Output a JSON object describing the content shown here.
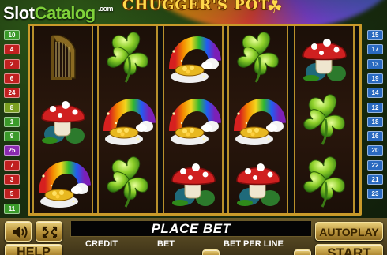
{
  "watermark": {
    "slot": "Slot",
    "catalog": "Catalog",
    "com": ".com"
  },
  "title": {
    "text": "CHUGGER'S POT"
  },
  "paylines": {
    "left": [
      "10",
      "4",
      "2",
      "6",
      "24",
      "8",
      "1",
      "9",
      "25",
      "7",
      "3",
      "5",
      "11"
    ],
    "right": [
      "15",
      "17",
      "13",
      "19",
      "14",
      "12",
      "18",
      "16",
      "20",
      "22",
      "21",
      "23"
    ]
  },
  "reels": [
    [
      "harp",
      "mushroom",
      "pot"
    ],
    [
      "clover",
      "pot",
      "clover"
    ],
    [
      "pot",
      "pot",
      "mushroom"
    ],
    [
      "clover",
      "pot",
      "mushroom"
    ],
    [
      "mushroom",
      "clover",
      "clover"
    ]
  ],
  "colors": {
    "frame_gold": "#c99a2a",
    "button_gold": "#e9d07a",
    "line_colors_left": [
      "#3a9a2a",
      "#c02020",
      "#c02020",
      "#c02020",
      "#c02020",
      "#7aa020",
      "#3a9a2a",
      "#3a9a2a",
      "#8a2ab0",
      "#c02020",
      "#c02020",
      "#c02020",
      "#3a9a2a"
    ],
    "line_colors_right": [
      "#2a6ac0",
      "#2a6ac0",
      "#2a6ac0",
      "#2a6ac0",
      "#2a6ac0",
      "#2a6ac0",
      "#2a6ac0",
      "#2a6ac0",
      "#2a6ac0",
      "#2a6ac0",
      "#2a6ac0",
      "#2a6ac0"
    ]
  },
  "controls": {
    "message": "PLACE BET",
    "credit_label": "CREDIT",
    "bet_label": "BET",
    "bet_per_line_label": "BET PER LINE",
    "autoplay_label": "AUTOPLAY",
    "hold_label": "HELP",
    "start_label": "START",
    "sound_icon": "speaker-icon",
    "fullscreen_icon": "fullscreen-icon"
  }
}
